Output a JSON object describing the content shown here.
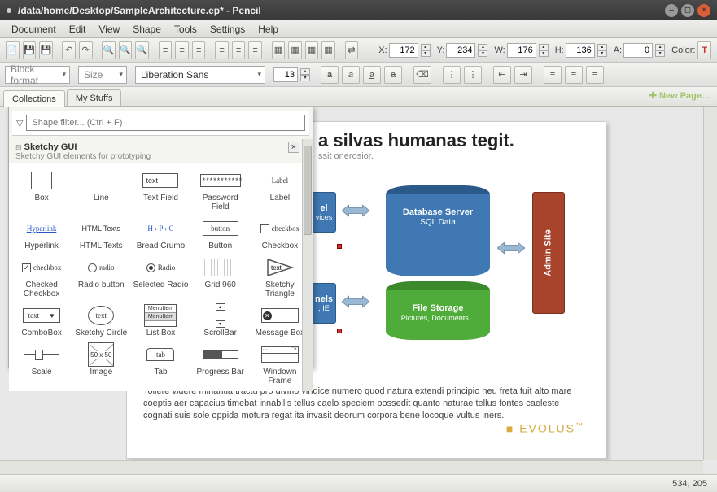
{
  "window": {
    "title": "/data/home/Desktop/SampleArchitecture.ep* - Pencil"
  },
  "menubar": [
    "Document",
    "Edit",
    "View",
    "Shape",
    "Tools",
    "Settings",
    "Help"
  ],
  "coords": {
    "x_label": "X:",
    "x": "172",
    "y_label": "Y:",
    "y": "234",
    "w_label": "W:",
    "w": "176",
    "h_label": "H:",
    "h": "136",
    "a_label": "A:",
    "a": "0",
    "color_label": "Color:"
  },
  "toolbar2": {
    "block_format": "Block format",
    "size": "Size",
    "font": "Liberation Sans",
    "font_size": "13"
  },
  "tabs": {
    "collections": "Collections",
    "mystuffs": "My Stuffs",
    "newpage": "New Page…"
  },
  "panel": {
    "filter_placeholder": "Shape filter... (Ctrl + F)",
    "group_title": "Sketchy GUI",
    "group_desc": "Sketchy GUI elements for prototyping",
    "shapes": [
      {
        "label": "Box",
        "thumb": "box"
      },
      {
        "label": "Line",
        "thumb": "line"
      },
      {
        "label": "Text Field",
        "thumb": "tf",
        "txt": "text"
      },
      {
        "label": "Password Field",
        "thumb": "pwd",
        "txt": "***********"
      },
      {
        "label": "Label",
        "thumb": "label",
        "txt": "Label"
      },
      {
        "label": "Hyperlink",
        "thumb": "link",
        "txt": "Hyperlink"
      },
      {
        "label": "HTML Texts",
        "thumb": "html",
        "txt": "HTML Texts"
      },
      {
        "label": "Bread Crumb",
        "thumb": "bc",
        "txt": "H › P › C"
      },
      {
        "label": "Button",
        "thumb": "btn",
        "txt": "button"
      },
      {
        "label": "Checkbox",
        "thumb": "cb",
        "txt": "checkbox"
      },
      {
        "label": "Checked Checkbox",
        "thumb": "cbc",
        "txt": "checkbox"
      },
      {
        "label": "Radio button",
        "thumb": "radio",
        "txt": "radio"
      },
      {
        "label": "Selected Radio",
        "thumb": "radios",
        "txt": "Radio"
      },
      {
        "label": "Grid 960",
        "thumb": "grid"
      },
      {
        "label": "Sketchy Triangle",
        "thumb": "tri",
        "txt": "text"
      },
      {
        "label": "ComboBox",
        "thumb": "combo",
        "txt": "text"
      },
      {
        "label": "Sketchy Circle",
        "thumb": "circle",
        "txt": "text"
      },
      {
        "label": "List Box",
        "thumb": "list"
      },
      {
        "label": "ScrollBar",
        "thumb": "scroll"
      },
      {
        "label": "Message Box",
        "thumb": "msg"
      },
      {
        "label": "Scale",
        "thumb": "slider"
      },
      {
        "label": "Image",
        "thumb": "img",
        "txt": "50 x 50"
      },
      {
        "label": "Tab",
        "thumb": "tab",
        "txt": "tab"
      },
      {
        "label": "Progress Bar",
        "thumb": "prog"
      },
      {
        "label": "Windown Frame",
        "thumb": "win"
      }
    ]
  },
  "page": {
    "title": "a silvas humanas tegit.",
    "subtitle": "ssit onerosior.",
    "box_left1": "el",
    "box_left1_sub": "vices",
    "box_left2": "nels",
    "box_left2_sub": ", IE",
    "db_title": "Database Server",
    "db_sub": "SQL Data",
    "fs_title": "File Storage",
    "fs_sub": "Pictures, Documents...",
    "admin": "Admin Site",
    "body_text": "Tollere videre minantia tractu pro divino vindice numero quod natura extendi principio neu freta fuit alto mare coeptis aer capacius timebat innabilis tellus caelo speciem possedit quanto naturae tellus fontes caeleste cognati suis sole oppida motura regat ita invasit deorum corpora bene locoque vultus iners.",
    "logo": "EVOLUS"
  },
  "status": {
    "coords": "534, 205"
  }
}
